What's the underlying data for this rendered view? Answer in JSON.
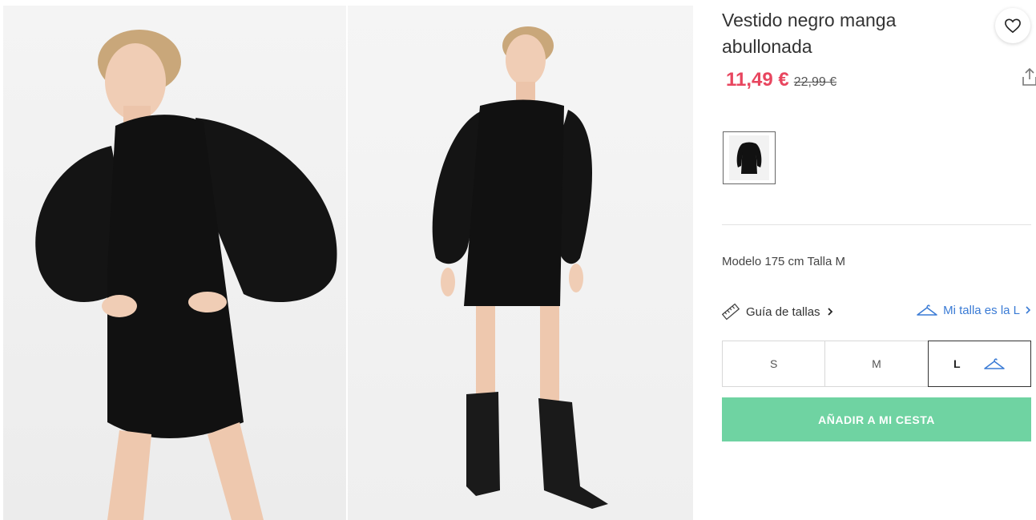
{
  "product": {
    "title": "Vestido negro manga abullonada",
    "price_current": "11,49 €",
    "price_original": "22,99 €"
  },
  "gallery": {
    "images": [
      {
        "name": "model-front-closeup"
      },
      {
        "name": "model-full-body-boots"
      }
    ]
  },
  "model_info": "Modelo 175 cm Talla M",
  "size_guide": {
    "label": "Guía de tallas",
    "my_size_label": "Mi talla es la L"
  },
  "sizes": [
    {
      "label": "S",
      "selected": false
    },
    {
      "label": "M",
      "selected": false
    },
    {
      "label": "L",
      "selected": true
    }
  ],
  "add_to_cart_label": "AÑADIR A MI CESTA",
  "colors": {
    "price": "#e8465f",
    "accent_blue": "#3a7bd5",
    "add_button": "#6fd3a2"
  },
  "icons": {
    "favorite": "heart-icon",
    "share": "share-icon",
    "ruler": "ruler-icon",
    "hanger": "hanger-icon",
    "chevron": "chevron-right-icon"
  }
}
